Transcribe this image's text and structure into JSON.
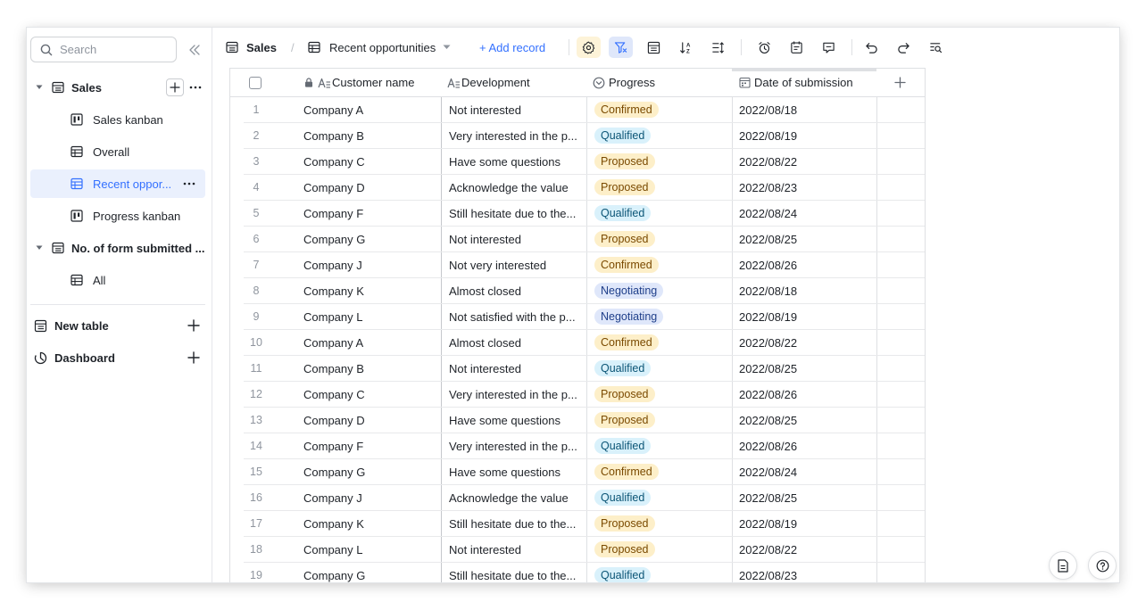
{
  "sidebar": {
    "search_placeholder": "Search",
    "tables": [
      {
        "name": "Sales",
        "views": [
          {
            "name": "Sales kanban",
            "icon": "kanban-icon"
          },
          {
            "name": "Overall",
            "icon": "grid-view-icon"
          },
          {
            "name": "Recent oppor...",
            "icon": "grid-view-icon",
            "active": true
          },
          {
            "name": "Progress kanban",
            "icon": "kanban-icon"
          }
        ]
      },
      {
        "name": "No. of form submitted ...",
        "views": [
          {
            "name": "All",
            "icon": "grid-view-icon"
          }
        ]
      }
    ],
    "new_table_label": "New table",
    "dashboard_label": "Dashboard"
  },
  "toolbar": {
    "table_name": "Sales",
    "separator": "/",
    "view_name": "Recent opportunities",
    "add_record_label": "+ Add record",
    "accent": "#3370ff"
  },
  "table": {
    "headers": {
      "customer": "Customer name",
      "development": "Development",
      "progress": "Progress",
      "date": "Date of submission"
    },
    "rows": [
      {
        "n": "1",
        "customer": "Company A",
        "development": "Not interested",
        "progress": "Confirmed",
        "date": "2022/08/18"
      },
      {
        "n": "2",
        "customer": "Company B",
        "development": "Very interested in the p...",
        "progress": "Qualified",
        "date": "2022/08/19"
      },
      {
        "n": "3",
        "customer": "Company C",
        "development": "Have some questions",
        "progress": "Proposed",
        "date": "2022/08/22"
      },
      {
        "n": "4",
        "customer": "Company D",
        "development": "Acknowledge the value",
        "progress": "Proposed",
        "date": "2022/08/23"
      },
      {
        "n": "5",
        "customer": "Company F",
        "development": "Still hesitate due to the...",
        "progress": "Qualified",
        "date": "2022/08/24"
      },
      {
        "n": "6",
        "customer": "Company G",
        "development": "Not interested",
        "progress": "Proposed",
        "date": "2022/08/25"
      },
      {
        "n": "7",
        "customer": "Company J",
        "development": "Not very interested",
        "progress": "Confirmed",
        "date": "2022/08/26"
      },
      {
        "n": "8",
        "customer": "Company K",
        "development": "Almost closed",
        "progress": "Negotiating",
        "date": "2022/08/18"
      },
      {
        "n": "9",
        "customer": "Company L",
        "development": "Not satisfied with the p...",
        "progress": "Negotiating",
        "date": "2022/08/19"
      },
      {
        "n": "10",
        "customer": "Company A",
        "development": "Almost closed",
        "progress": "Confirmed",
        "date": "2022/08/22"
      },
      {
        "n": "11",
        "customer": "Company B",
        "development": "Not interested",
        "progress": "Qualified",
        "date": "2022/08/25"
      },
      {
        "n": "12",
        "customer": "Company C",
        "development": "Very interested in the p...",
        "progress": "Proposed",
        "date": "2022/08/26"
      },
      {
        "n": "13",
        "customer": "Company D",
        "development": "Have some questions",
        "progress": "Proposed",
        "date": "2022/08/25"
      },
      {
        "n": "14",
        "customer": "Company F",
        "development": "Very interested in the p...",
        "progress": "Qualified",
        "date": "2022/08/26"
      },
      {
        "n": "15",
        "customer": "Company G",
        "development": "Have some questions",
        "progress": "Confirmed",
        "date": "2022/08/24"
      },
      {
        "n": "16",
        "customer": "Company J",
        "development": "Acknowledge the value",
        "progress": "Qualified",
        "date": "2022/08/25"
      },
      {
        "n": "17",
        "customer": "Company K",
        "development": "Still hesitate due to the...",
        "progress": "Proposed",
        "date": "2022/08/19"
      },
      {
        "n": "18",
        "customer": "Company L",
        "development": "Not interested",
        "progress": "Proposed",
        "date": "2022/08/22"
      },
      {
        "n": "19",
        "customer": "Company G",
        "development": "Still hesitate due to the...",
        "progress": "Qualified",
        "date": "2022/08/23"
      }
    ],
    "tag_colors": {
      "Confirmed": {
        "bg": "#fdefc9",
        "fg": "#7a4a00"
      },
      "Proposed": {
        "bg": "#fdefc9",
        "fg": "#7a4a00"
      },
      "Qualified": {
        "bg": "#d9f1fb",
        "fg": "#0b5576"
      },
      "Negotiating": {
        "bg": "#dfe7fa",
        "fg": "#1f3f8a"
      }
    }
  }
}
